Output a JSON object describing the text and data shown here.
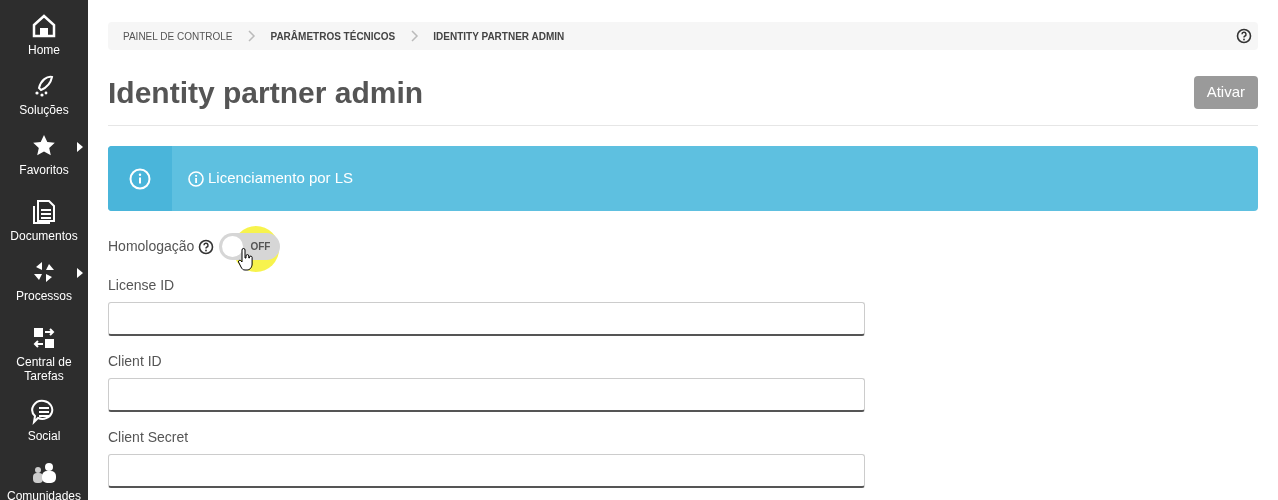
{
  "sidebar": {
    "items": [
      {
        "label": "Home",
        "has_submenu": false
      },
      {
        "label": "Soluções",
        "has_submenu": false
      },
      {
        "label": "Favoritos",
        "has_submenu": true
      },
      {
        "label": "Documentos",
        "has_submenu": false
      },
      {
        "label": "Processos",
        "has_submenu": true
      },
      {
        "label": "Central de Tarefas",
        "has_submenu": false
      },
      {
        "label": "Social",
        "has_submenu": false
      },
      {
        "label": "Comunidades",
        "has_submenu": false
      }
    ]
  },
  "breadcrumb": [
    {
      "label": "PAINEL DE CONTROLE",
      "current": false
    },
    {
      "label": "PARÂMETROS TÉCNICOS",
      "current": true
    },
    {
      "label": "IDENTITY PARTNER ADMIN",
      "current": true
    }
  ],
  "page_title": "Identity partner admin",
  "activate_button": {
    "label": "Ativar",
    "disabled": true
  },
  "alert": {
    "text": "Licenciamento por LS"
  },
  "homologation": {
    "label": "Homologação",
    "toggle_text": "OFF",
    "on": false
  },
  "fields": [
    {
      "label": "License ID"
    },
    {
      "label": "Client ID"
    },
    {
      "label": "Client Secret"
    }
  ]
}
